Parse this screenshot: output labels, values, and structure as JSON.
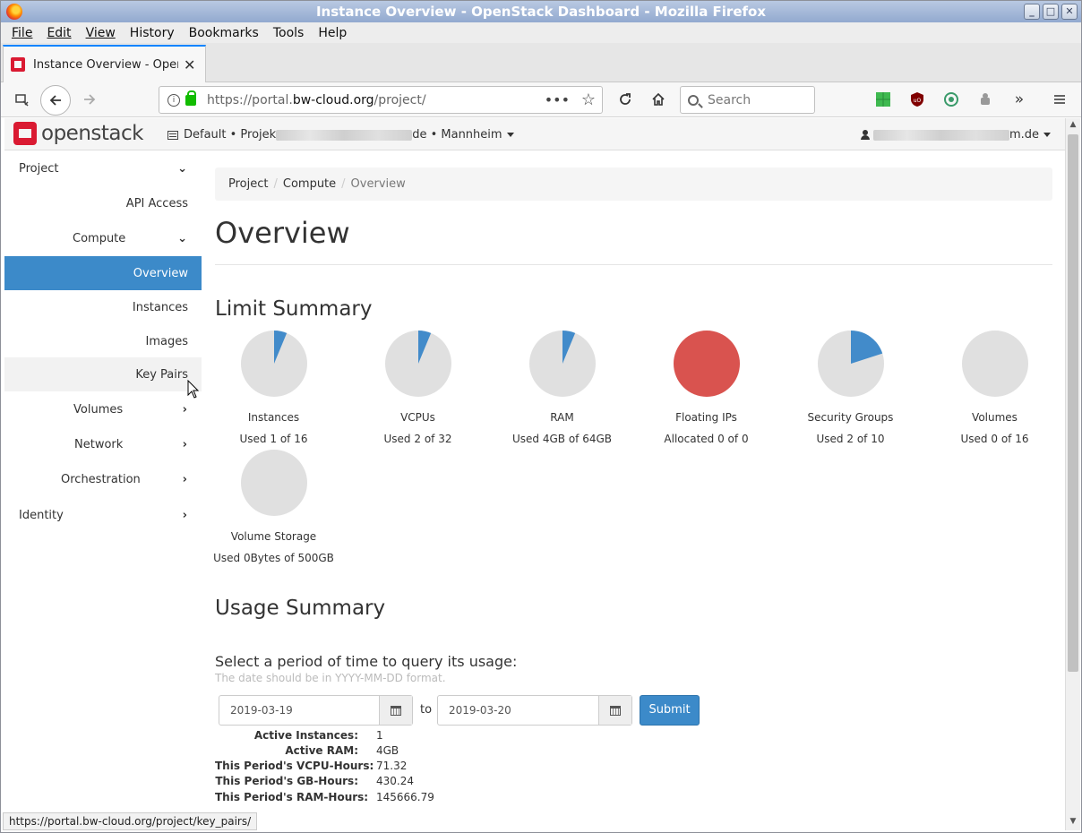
{
  "window": {
    "title": "Instance Overview - OpenStack Dashboard - Mozilla Firefox"
  },
  "menu": [
    "File",
    "Edit",
    "View",
    "History",
    "Bookmarks",
    "Tools",
    "Help"
  ],
  "tab": {
    "label": "Instance Overview - OpenStack Dashboard"
  },
  "urlbar": {
    "prefix": "https://portal.",
    "domain": "bw-cloud.org",
    "path": "/project/"
  },
  "search": {
    "placeholder": "Search"
  },
  "header": {
    "logo_text": "openstack",
    "project_start": "Default • Projek",
    "project_end": "de • Mannheim",
    "user_end": "m.de"
  },
  "sidebar": {
    "project": "Project",
    "api_access": "API Access",
    "compute": "Compute",
    "overview": "Overview",
    "instances": "Instances",
    "images": "Images",
    "key_pairs": "Key Pairs",
    "volumes": "Volumes",
    "network": "Network",
    "orchestration": "Orchestration",
    "identity": "Identity"
  },
  "breadcrumb": {
    "a": "Project",
    "b": "Compute",
    "c": "Overview",
    "sep": "/"
  },
  "page_title": "Overview",
  "limit_summary": {
    "title": "Limit Summary",
    "colors": {
      "used": "#428bca",
      "free": "#e0e0e0",
      "full": "#d9534f"
    },
    "items": [
      {
        "label": "Instances",
        "value": "Used 1 of 16",
        "used": 1,
        "total": 16
      },
      {
        "label": "VCPUs",
        "value": "Used 2 of 32",
        "used": 2,
        "total": 32
      },
      {
        "label": "RAM",
        "value": "Used 4GB of 64GB",
        "used": 4,
        "total": 64
      },
      {
        "label": "Floating IPs",
        "value": "Allocated 0 of 0",
        "used": 0,
        "total": 0
      },
      {
        "label": "Security Groups",
        "value": "Used 2 of 10",
        "used": 2,
        "total": 10
      },
      {
        "label": "Volumes",
        "value": "Used 0 of 16",
        "used": 0,
        "total": 16
      },
      {
        "label": "Volume Storage",
        "value": "Used 0Bytes of 500GB",
        "used": 0,
        "total": 500
      }
    ]
  },
  "usage_summary": {
    "title": "Usage Summary",
    "question": "Select a period of time to query its usage:",
    "hint": "The date should be in YYYY-MM-DD format.",
    "start": "2019-03-19",
    "to_label": "to",
    "end": "2019-03-20",
    "submit": "Submit",
    "stats": [
      {
        "k": "Active Instances:",
        "v": "1"
      },
      {
        "k": "Active RAM:",
        "v": "4GB"
      },
      {
        "k": "This Period's VCPU-Hours:",
        "v": "71.32"
      },
      {
        "k": "This Period's GB-Hours:",
        "v": "430.24"
      },
      {
        "k": "This Period's RAM-Hours:",
        "v": "145666.79"
      }
    ]
  },
  "statusbar": "https://portal.bw-cloud.org/project/key_pairs/"
}
